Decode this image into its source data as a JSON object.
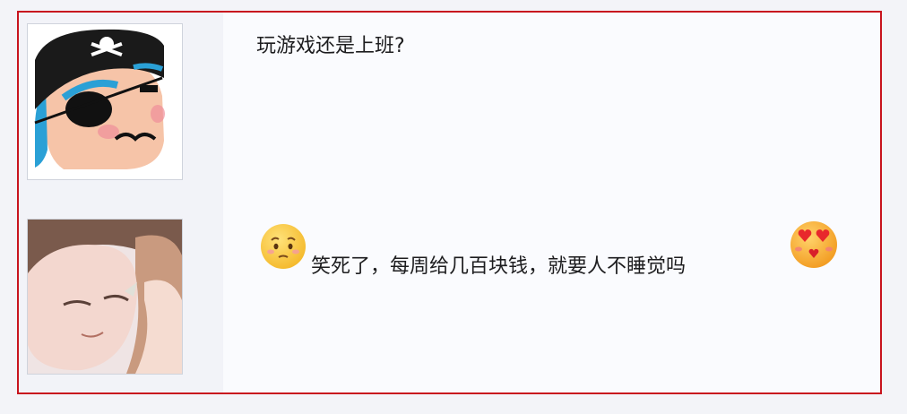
{
  "comments": [
    {
      "avatar_icon": "pirate-cartoon-avatar",
      "text": "玩游戏还是上班?"
    },
    {
      "avatar_icon": "anime-couple-avatar",
      "leading_emoji": "worried-face-emoji",
      "text": "笑死了，每周给几百块钱，就要人不睡觉吗",
      "trailing_emoji": "heart-eyes-kiss-emoji"
    }
  ],
  "colors": {
    "frame_border": "#c8141e",
    "emoji_yellow": "#f9c93b"
  }
}
